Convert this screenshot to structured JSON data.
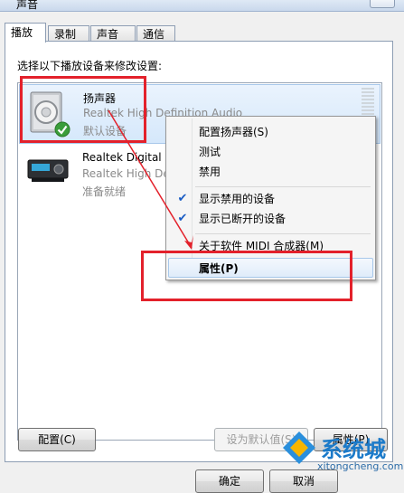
{
  "window": {
    "title": "声音"
  },
  "tabs": [
    {
      "label": "播放"
    },
    {
      "label": "录制"
    },
    {
      "label": "声音"
    },
    {
      "label": "通信"
    }
  ],
  "prompt": "选择以下播放设备来修改设置:",
  "devices": [
    {
      "name": "扬声器",
      "description": "Realtek High Definition Audio",
      "status": "默认设备",
      "icon": "speaker-icon",
      "badge": "default-check-icon"
    },
    {
      "name": "Realtek Digital O",
      "description": "Realtek High Def",
      "status": "准备就绪",
      "icon": "digital-output-icon"
    }
  ],
  "context_menu": {
    "items": [
      {
        "label": "配置扬声器(S)",
        "checked": false
      },
      {
        "label": "测试",
        "checked": false
      },
      {
        "label": "禁用",
        "checked": false
      },
      {
        "label": "显示禁用的设备",
        "checked": true
      },
      {
        "label": "显示已断开的设备",
        "checked": true
      },
      {
        "label": "关于软件 MIDI 合成器(M)",
        "checked": false
      },
      {
        "label": "属性(P)",
        "checked": false,
        "highlighted": true
      }
    ]
  },
  "buttons": {
    "configure": "配置(C)",
    "set_default": "设为默认值(S)",
    "properties": "属性(P)",
    "ok": "确定",
    "cancel": "取消"
  },
  "watermark": {
    "text": "系统城",
    "url": "xitongcheng.com"
  },
  "colors": {
    "annotation_red": "#e3212b",
    "selection": "#d5e8fb",
    "check_blue": "#1a5cc4"
  }
}
